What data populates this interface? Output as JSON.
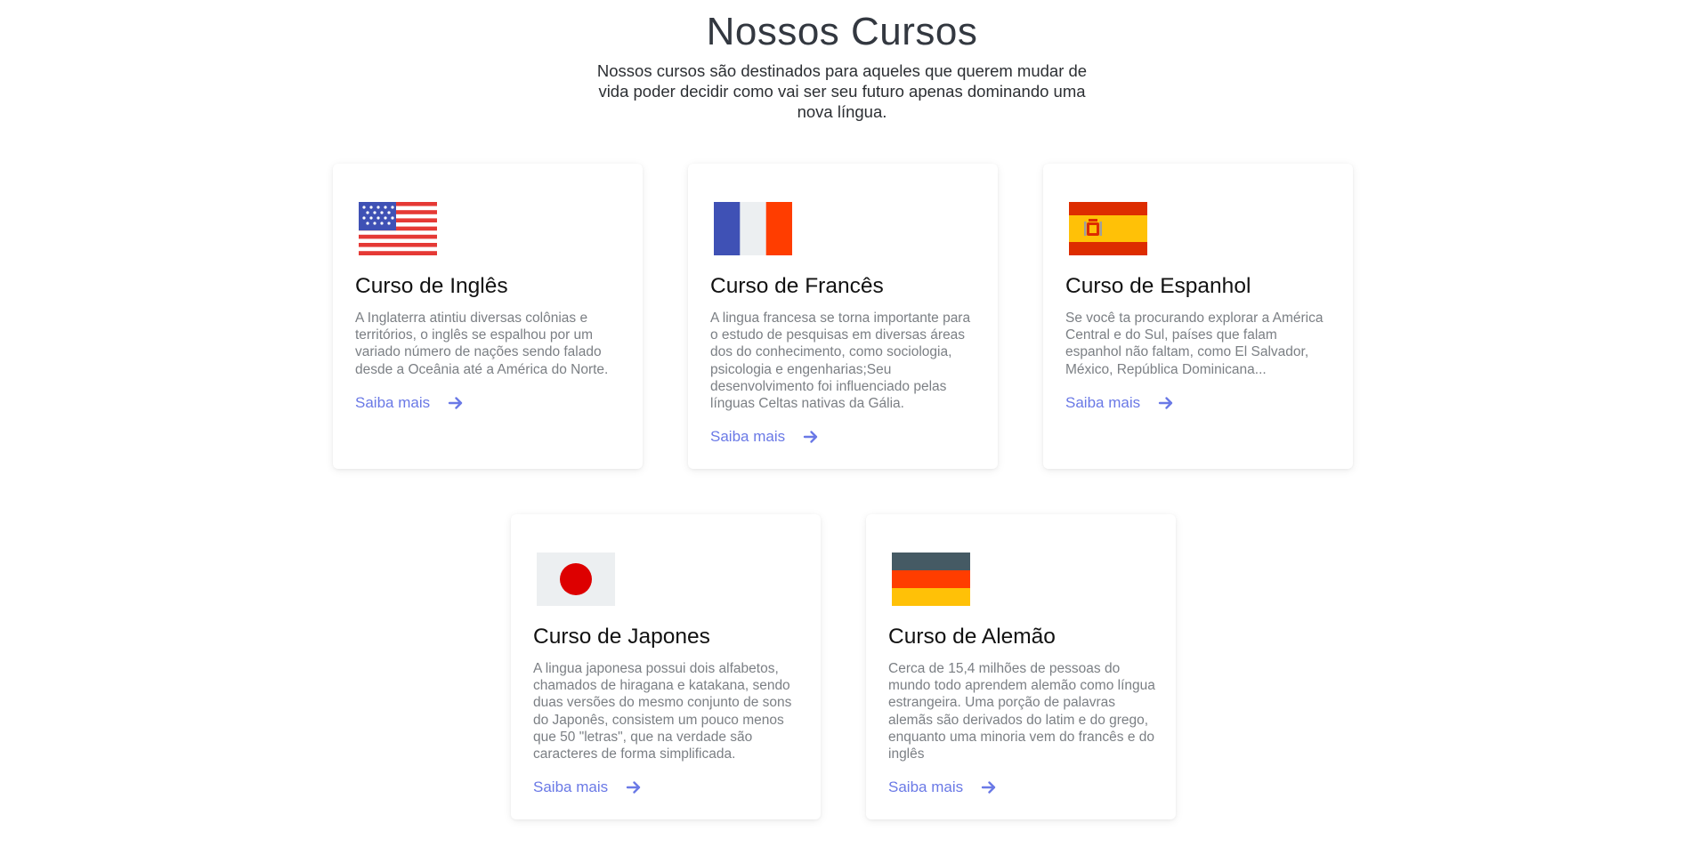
{
  "header": {
    "title": "Nossos Cursos",
    "subtitle": "Nossos cursos são destinados para aqueles que querem mudar de vida poder decidir como vai ser seu futuro apenas dominando uma nova língua."
  },
  "colors": {
    "link": "#6a79e6",
    "title": "#333840",
    "description": "#7b7f84"
  },
  "courses": [
    {
      "flag_icon": "usa-flag-icon",
      "title": "Curso de Inglês",
      "description": "A Inglaterra atintiu diversas colônias e territórios, o inglês se espalhou por um variado número de nações sendo falado desde a Oceânia até a América do Norte.",
      "link": "Saiba mais"
    },
    {
      "flag_icon": "france-flag-icon",
      "title": "Curso de Francês",
      "description": "A lingua francesa se torna importante para o estudo de pesquisas em diversas áreas dos do conhecimento, como sociologia, psicologia e engenharias;Seu desenvolvimento foi influenciado pelas línguas Celtas nativas da Gália.",
      "link": "Saiba mais"
    },
    {
      "flag_icon": "spain-flag-icon",
      "title": "Curso de Espanhol",
      "description": "Se você ta procurando explorar a América Central e do Sul, países que falam espanhol não faltam, como El Salvador, México, República Dominicana...",
      "link": "Saiba mais"
    },
    {
      "flag_icon": "japan-flag-icon",
      "title": "Curso de Japones",
      "description": "A lingua japonesa possui dois alfabetos, chamados de hiragana e katakana, sendo duas versões do mesmo conjunto de sons do Japonês, consistem um pouco menos que 50 \"letras\", que na verdade são caracteres de forma simplificada.",
      "link": "Saiba mais"
    },
    {
      "flag_icon": "germany-flag-icon",
      "title": "Curso de Alemão",
      "description": "Cerca de 15,4 milhões de pessoas do mundo todo aprendem alemão como língua estrangeira. Uma porção de palavras alemãs são derivados do latim e do grego, enquanto uma minoria vem do francês e do inglês",
      "link": "Saiba mais"
    }
  ]
}
